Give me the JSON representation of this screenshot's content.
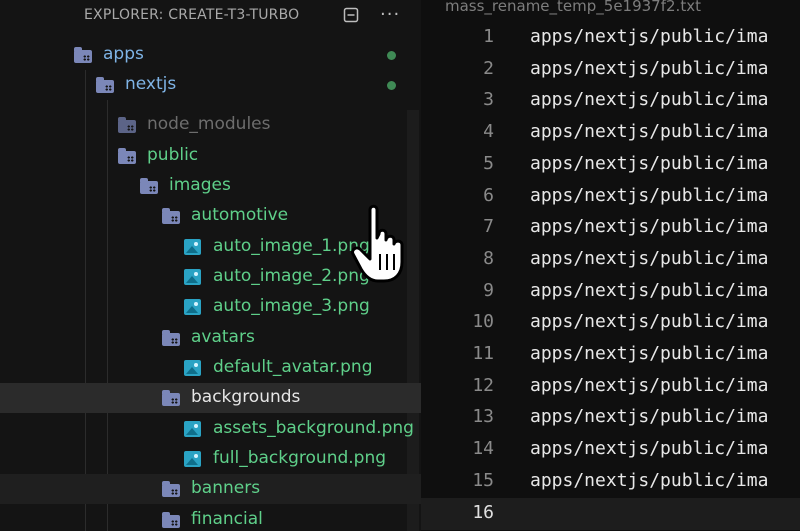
{
  "explorer": {
    "title": "EXPLORER: CREATE-T3-TURBO",
    "actions": [
      "collapse-all-icon",
      "more-actions-icon"
    ]
  },
  "tree": [
    {
      "name": "apps",
      "kind": "folder",
      "depth": 0,
      "dot": true
    },
    {
      "name": "nextjs",
      "kind": "folder",
      "depth": 1,
      "dot": true
    },
    {
      "name": "node_modules",
      "kind": "folder",
      "depth": 2,
      "dimmed": true
    },
    {
      "name": "public",
      "kind": "folder",
      "depth": 2
    },
    {
      "name": "images",
      "kind": "folder",
      "depth": 3
    },
    {
      "name": "automotive",
      "kind": "folder",
      "depth": 4
    },
    {
      "name": "auto_image_1.png",
      "kind": "image",
      "depth": 5
    },
    {
      "name": "auto_image_2.png",
      "kind": "image",
      "depth": 5
    },
    {
      "name": "auto_image_3.png",
      "kind": "image",
      "depth": 5
    },
    {
      "name": "avatars",
      "kind": "folder",
      "depth": 4
    },
    {
      "name": "default_avatar.png",
      "kind": "image",
      "depth": 5
    },
    {
      "name": "backgrounds",
      "kind": "folder",
      "depth": 4,
      "selected": true
    },
    {
      "name": "assets_background.png",
      "kind": "image",
      "depth": 5
    },
    {
      "name": "full_background.png",
      "kind": "image",
      "depth": 5
    },
    {
      "name": "banners",
      "kind": "folder",
      "depth": 4,
      "hover": true
    },
    {
      "name": "financial",
      "kind": "folder",
      "depth": 4
    }
  ],
  "editor": {
    "filename": "mass_rename_temp_5e1937f2.txt",
    "current_line": 16,
    "lines": [
      "apps/nextjs/public/ima",
      "apps/nextjs/public/ima",
      "apps/nextjs/public/ima",
      "apps/nextjs/public/ima",
      "apps/nextjs/public/ima",
      "apps/nextjs/public/ima",
      "apps/nextjs/public/ima",
      "apps/nextjs/public/ima",
      "apps/nextjs/public/ima",
      "apps/nextjs/public/ima",
      "apps/nextjs/public/ima",
      "apps/nextjs/public/ima",
      "apps/nextjs/public/ima",
      "apps/nextjs/public/ima",
      "apps/nextjs/public/ima",
      ""
    ]
  },
  "colors": {
    "tree_text": "#5fd08a",
    "selected_text": "#e6e6e6",
    "git_dot": "#3f8a55",
    "folder_icon": "#7b87b8",
    "image_icon": "#2aa3c4"
  }
}
